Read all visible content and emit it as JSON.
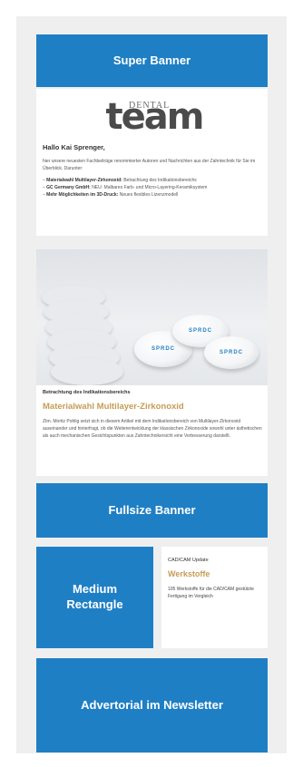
{
  "banners": {
    "super": "Super Banner",
    "fullsize": "Fullsize Banner",
    "medium": "Medium Rectangle",
    "advertorial": "Advertorial im Newsletter"
  },
  "newsletter": {
    "logo_small": "DENTAL",
    "logo_big": "team",
    "greeting": "Hallo Kai Sprenger,",
    "intro": "hier unsere neuesten Fachbeiträge renommierter Autoren und Nachrichten aus der Zahntechnik für Sie im Überblick. Darunter:",
    "bullets": [
      {
        "title": "Materialwahl Multilayer-Zirkonoxid:",
        "text": "Betrachtung des Indikationsbereichs"
      },
      {
        "title": "GC Germany GmbH:",
        "text": "NEU: Malbares Farb- und Micro-Layering-Keramiksystem"
      },
      {
        "title": "Mehr Möglichkeiten im 3D-Druck:",
        "text": "Neues flexibles Lizenzmodell"
      }
    ]
  },
  "article": {
    "category": "Betrachtung des Indikationsbereichs",
    "title": "Materialwahl Multilayer-Zirkonoxid",
    "body": "Ztm. Moritz Pohlig setzt sich in diesem Artikel mit dem Indikationsbereich von Multilayer-Zirkonoxid auseinander und hinterfragt, ob die Weiterentwicklung der klassischen Zirkonoxide sowohl unter ästhetischen als auch mechanischen Gesichtspunkten aus Zahntechnikersicht eine Verbesserung darstellt.",
    "disc_label": "SPRDC"
  },
  "cadcam": {
    "category": "CAD/CAM Update",
    "title": "Werkstoffe",
    "body": "105 Werkstoffe für die CAD/CAM gestützte Fertigung im Vergleich"
  },
  "colors": {
    "banner_blue": "#1f7fc4",
    "accent_gold": "#c69c55",
    "frame_gray": "#efefef"
  }
}
